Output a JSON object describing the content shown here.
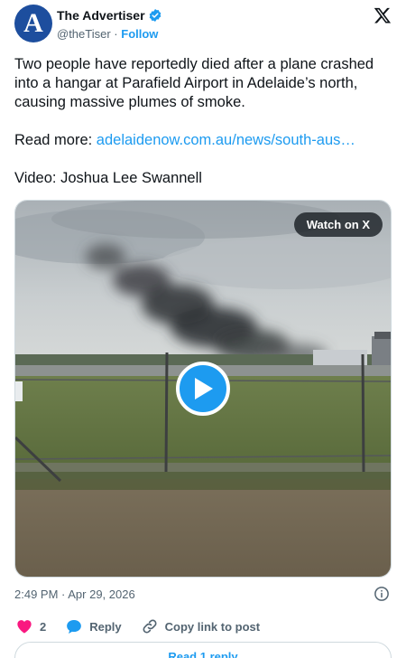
{
  "author": {
    "avatar_letter": "A",
    "display_name": "The Advertiser",
    "handle": "@theTiser",
    "separator": " · ",
    "follow_label": "Follow"
  },
  "tweet": {
    "paragraph1": "Two people have reportedly died after a plane crashed into a hangar at Parafield Airport in Adelaide’s north, causing massive plumes of smoke.",
    "read_more_prefix": "Read more: ",
    "read_more_link": "adelaidenow.com.au/news/south-aus…",
    "video_credit": "Video: Joshua Lee Swannell"
  },
  "media": {
    "watch_label": "Watch on X"
  },
  "meta": {
    "timestamp": "2:49 PM · Apr 29, 2026"
  },
  "actions": {
    "like_count": "2",
    "reply_label": "Reply",
    "copy_link_label": "Copy link to post"
  },
  "footer": {
    "read_replies_label": "Read 1 reply"
  },
  "colors": {
    "accent": "#1d9bf0",
    "like": "#f91880",
    "secondary_text": "#536471"
  }
}
